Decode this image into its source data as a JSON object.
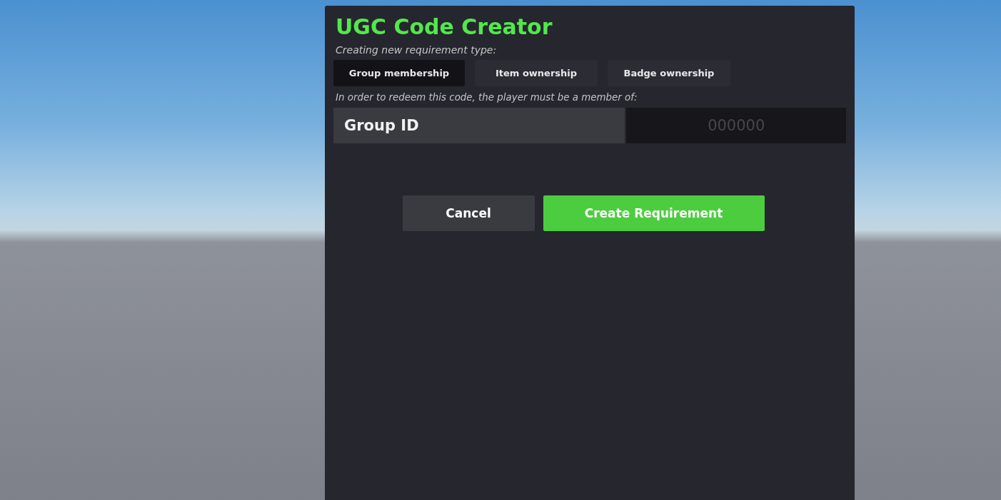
{
  "title": "UGC Code Creator",
  "subtitle": "Creating new requirement type:",
  "tabs": [
    {
      "label": "Group membership",
      "selected": true
    },
    {
      "label": "Item ownership",
      "selected": false
    },
    {
      "label": "Badge ownership",
      "selected": false
    }
  ],
  "description": "In order to redeem this code, the player must be a member of:",
  "field": {
    "label": "Group ID",
    "placeholder": "000000"
  },
  "buttons": [
    {
      "label": "Cancel",
      "kind": "secondary"
    },
    {
      "label": "Create Requirement",
      "kind": "primary"
    }
  ]
}
